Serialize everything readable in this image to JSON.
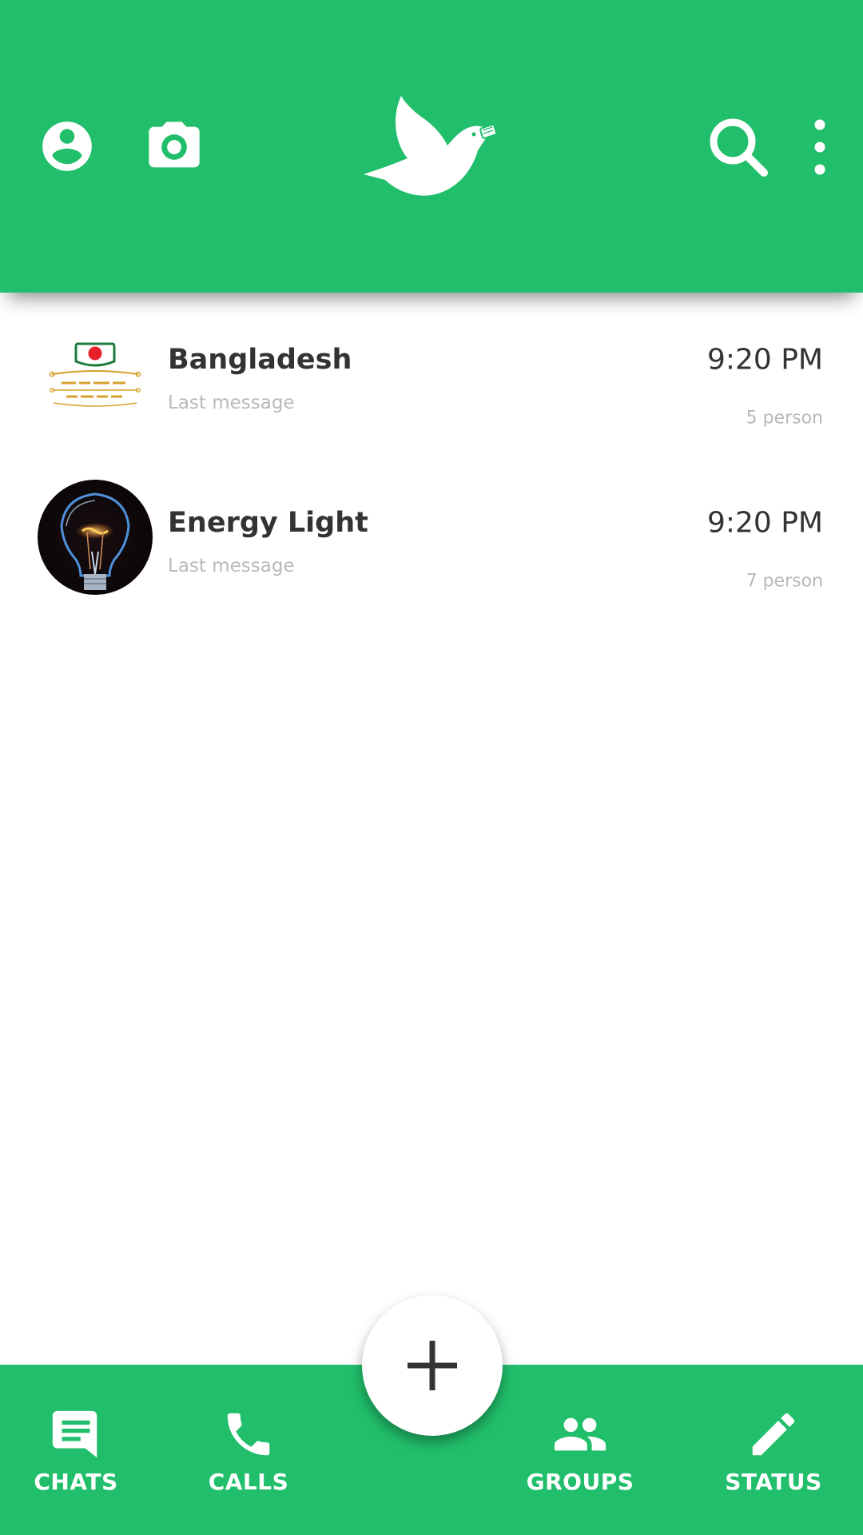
{
  "theme": {
    "accent": "#21bf6b",
    "background": "#ffffff",
    "text_dark": "#333333",
    "text_muted": "#b9b9b9"
  },
  "header": {
    "left_icons": [
      "profile-icon",
      "camera-icon"
    ],
    "logo": "dove-logo",
    "right_icons": [
      "search-icon",
      "more-vertical-icon"
    ]
  },
  "chats": [
    {
      "name": "Bangladesh",
      "last_message": "Last message",
      "time": "9:20 PM",
      "members": "5 person",
      "avatar": "bangladesh-television-logo"
    },
    {
      "name": "Energy Light",
      "last_message": "Last message",
      "time": "9:20 PM",
      "members": "7 person",
      "avatar": "light-bulb-image"
    }
  ],
  "fab": {
    "icon": "plus-icon"
  },
  "bottom_nav": [
    {
      "label": "CHATS",
      "icon": "chat-icon"
    },
    {
      "label": "CALLS",
      "icon": "phone-icon"
    },
    {
      "label": "GROUPS",
      "icon": "groups-icon"
    },
    {
      "label": "STATUS",
      "icon": "pencil-icon"
    }
  ]
}
